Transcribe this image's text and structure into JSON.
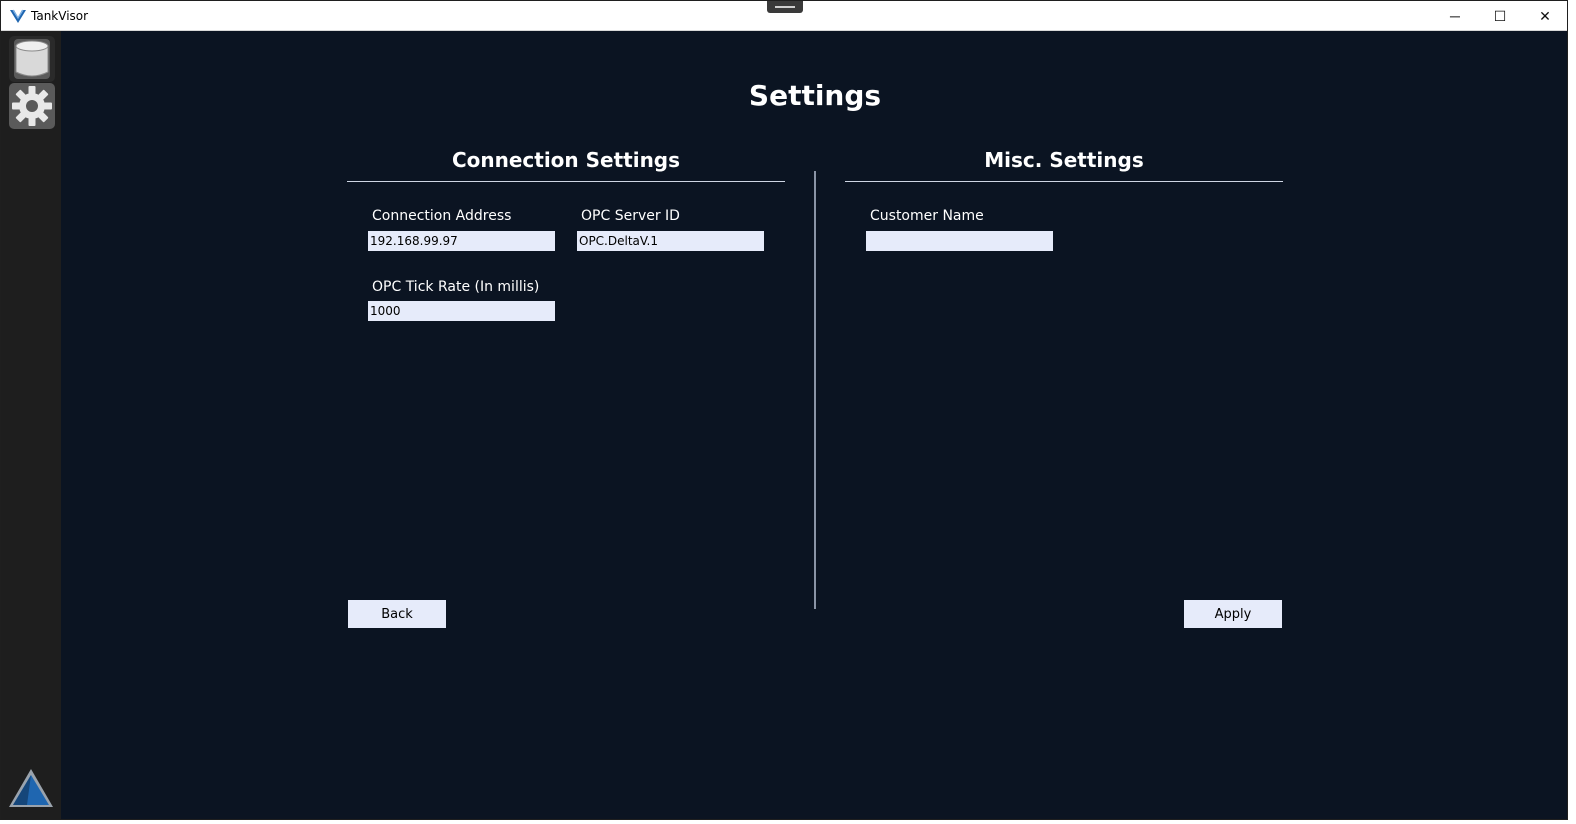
{
  "window": {
    "title": "TankVisor",
    "controls": {
      "minimize": "─",
      "maximize": "☐",
      "close": "✕"
    }
  },
  "sidebar": {
    "items": [
      {
        "icon": "database-icon",
        "label": "Tanks"
      },
      {
        "icon": "gear-icon",
        "label": "Settings",
        "active": true
      }
    ],
    "footer_icon": "company-logo-icon"
  },
  "page": {
    "title": "Settings"
  },
  "connection": {
    "title": "Connection Settings",
    "address_label": "Connection Address",
    "address_value": "192.168.99.97",
    "server_id_label": "OPC Server ID",
    "server_id_value": "OPC.DeltaV.1",
    "tick_rate_label": "OPC Tick Rate (In millis)",
    "tick_rate_value": "1000"
  },
  "misc": {
    "title": "Misc. Settings",
    "customer_label": "Customer Name",
    "customer_value": ""
  },
  "buttons": {
    "back": "Back",
    "apply": "Apply"
  },
  "colors": {
    "background": "#0b1422",
    "sidebar": "#1e1e1e",
    "input_bg": "#e6ebfa",
    "text": "#ffffff",
    "logo_blue": "#1f66b0"
  }
}
